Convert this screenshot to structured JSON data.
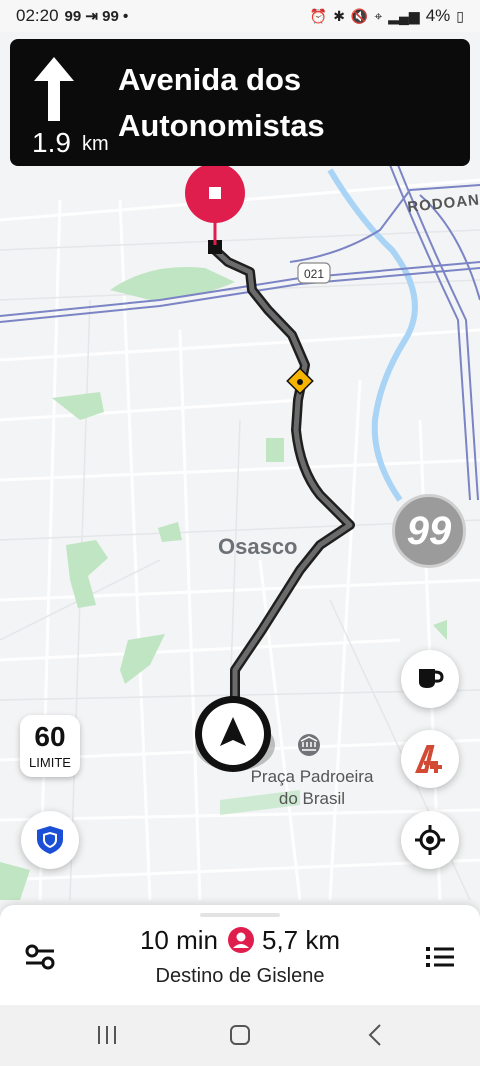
{
  "status_bar": {
    "time": "02:20",
    "left_icons": "99 ⇥ 99 •",
    "battery": "4%"
  },
  "nav_banner": {
    "distance_value": "1.9",
    "distance_unit": "km",
    "street_name": "Avenida dos Autonomistas"
  },
  "map": {
    "city_label": "Osasco",
    "road_label": "RODOAN",
    "road_shield": "021",
    "poi_label": "Praça Padroeira do Brasil",
    "route_color": "#333333",
    "destination_color": "#e01e4e"
  },
  "speed_limit": {
    "value": "60",
    "label": "LIMITE"
  },
  "brand": {
    "logo_text": "99"
  },
  "bottom_card": {
    "eta_time": "10 min",
    "eta_distance": "5,7 km",
    "destination": "Destino de Gislene"
  }
}
